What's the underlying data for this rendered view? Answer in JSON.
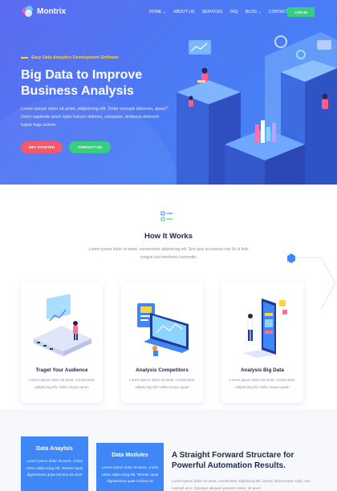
{
  "nav": {
    "logo_text": "Montrix",
    "items": [
      {
        "label": "HOME ⌄"
      },
      {
        "label": "ABOUT US"
      },
      {
        "label": "SERVICES"
      },
      {
        "label": "FAQ"
      },
      {
        "label": "BLOG ⌄"
      },
      {
        "label": "CONTACT"
      }
    ],
    "login_label": "LOG IN"
  },
  "hero": {
    "tagline": "Easy Data Analytics Development Software",
    "title": "Big Data to Improve Business Analysis",
    "description": "Lorem ipsum dolor sit amet, adipisicing elit. Dolor corrupti laborum, quasi? Dolor sapiente amet optio harum dolores, voluptate, tempora dolorem fugiat fuga autem.",
    "cta_primary": "GET STARTED",
    "cta_secondary": "CONTACT US"
  },
  "how": {
    "title": "How It Works",
    "description": "Lorem ipsum dolor sit amet, consectetur adipisicing elit. Sed quis accumsan nisi Ut ut felis congue nisl hendrerit commodo.",
    "cards": [
      {
        "title": "Traget Your Audience",
        "text": "Lorem ipsum dolor sit amet, consectetur adipiscing elit. Nulla neque quam"
      },
      {
        "title": "Analysis Competitors",
        "text": "Lorem ipsum dolor sit amet, consectetur adipiscing elit. Nulla neque quam"
      },
      {
        "title": "Analysis Big Data",
        "text": "Lorem ipsum dolor sit amet, consectetur adipiscing elit. Nulla neque quam"
      }
    ]
  },
  "features": {
    "card1": {
      "title": "Data Anaylsis",
      "text": "Lorem ipsum dolor sit amet, conse ctetur adipi scing elit. Tenetur quae dignissimos quae minima sit amet"
    },
    "card2": {
      "title": "Data Modules",
      "text": "Lorem ipsum dolor sit amet, conse ctetur adipi scing elit. Tenetur quae dignissimos quae minima sit"
    },
    "heading": "A Straight Forward Structare for Powerful Automation Results.",
    "description": "Lorem ipsum dolor sit amet, consectetur adipiscing elit. Donec ullamcorper nulla, non suscipit arcu. Quisque aliquam posuere tortor, sit amet"
  },
  "colors": {
    "hero_start": "#5b6cf0",
    "hero_end": "#3f86f6",
    "accent_red": "#f4586a",
    "accent_green": "#35d07f",
    "accent_yellow": "#ffd23f",
    "heading": "#1f2a44"
  }
}
